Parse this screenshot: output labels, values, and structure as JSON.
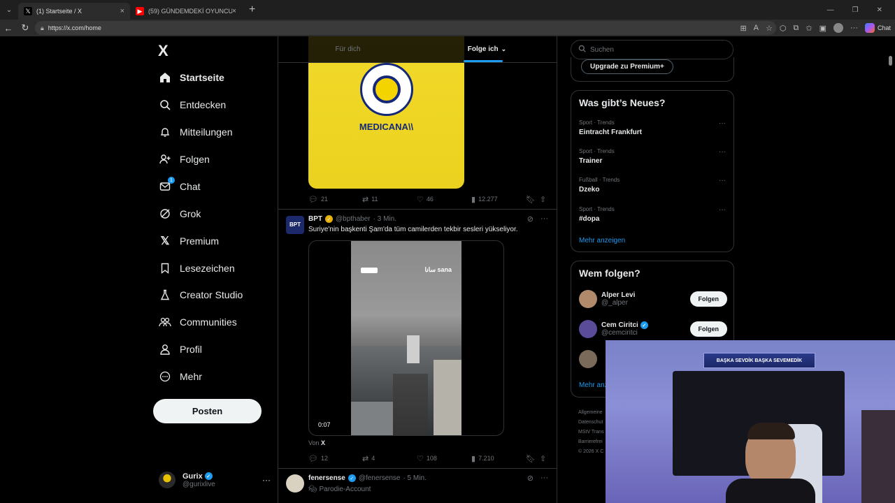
{
  "browser": {
    "tabs": [
      {
        "title": "(1) Startseite / X",
        "active": true
      },
      {
        "title": "(59) GÜNDEMDEKİ OYUNCULARD",
        "active": false
      }
    ],
    "url": "https://x.com/home",
    "chat_label": "Chat"
  },
  "nav": {
    "logo": "X",
    "items": [
      {
        "label": "Startseite",
        "icon": "home-icon",
        "active": true
      },
      {
        "label": "Entdecken",
        "icon": "search-icon"
      },
      {
        "label": "Mitteilungen",
        "icon": "bell-icon"
      },
      {
        "label": "Folgen",
        "icon": "person-add-icon"
      },
      {
        "label": "Chat",
        "icon": "mail-icon",
        "badge": "1"
      },
      {
        "label": "Grok",
        "icon": "grok-icon"
      },
      {
        "label": "Premium",
        "icon": "x-premium-icon"
      },
      {
        "label": "Lesezeichen",
        "icon": "bookmark-icon"
      },
      {
        "label": "Creator Studio",
        "icon": "creator-studio-icon"
      },
      {
        "label": "Communities",
        "icon": "communities-icon"
      },
      {
        "label": "Profil",
        "icon": "profile-icon"
      },
      {
        "label": "Mehr",
        "icon": "more-icon"
      }
    ],
    "post_button": "Posten",
    "account": {
      "name": "Gurix",
      "handle": "@gurixlive",
      "more": "···"
    }
  },
  "feed": {
    "tabs": [
      {
        "label": "Für dich",
        "active": false
      },
      {
        "label": "Folge ich",
        "active": true
      }
    ],
    "image_post": {
      "sponsor_text": "MEDICANA\\\\",
      "crest_text": "FENERBAHÇE SPOR KULÜBÜ 1907",
      "actions": {
        "replies": "21",
        "reposts": "11",
        "likes": "46",
        "views": "12.277"
      }
    },
    "bpt_post": {
      "name": "BPT",
      "handle": "@bpthaber",
      "time": "· 3 Min.",
      "text": "Suriye'nin başkenti Şam'da tüm camilerden tekbir sesleri yükseliyor.",
      "video_time": "0:07",
      "video_logo": "سانا\nsana",
      "from_label": "Von",
      "from_source": "X",
      "actions": {
        "replies": "12",
        "reposts": "4",
        "likes": "108",
        "views": "7.210"
      }
    },
    "fener_post": {
      "name": "fenersense",
      "handle": "@fenersense",
      "time": "· 5 Min.",
      "subtitle": "Parodie-Account"
    }
  },
  "sidebar": {
    "search_placeholder": "Suchen",
    "upgrade_label": "Upgrade zu Premium+",
    "trends_title": "Was gibt’s Neues?",
    "trends": [
      {
        "category": "Sport · Trends",
        "name": "Eintracht Frankfurt"
      },
      {
        "category": "Sport · Trends",
        "name": "Trainer"
      },
      {
        "category": "Fußball · Trends",
        "name": "Dzeko"
      },
      {
        "category": "Sport · Trends",
        "name": "#dopa"
      }
    ],
    "show_more": "Mehr anzeigen",
    "who_title": "Wem folgen?",
    "who": [
      {
        "name": "Alper Levi",
        "handle": "@_alper",
        "button": "Folgen"
      },
      {
        "name": "Cem Ciritci",
        "handle": "@cemciritci",
        "button": "Folgen",
        "verified": true
      }
    ],
    "who_show_more": "Mehr anz",
    "footer": [
      "Allgemeine",
      "Datenschut",
      "MStV Trans",
      "Barrierefrei",
      "© 2026 X C"
    ]
  },
  "webcam": {
    "banner": "BAŞKA SEVDİK BAŞKA SEVEMEDİK"
  },
  "colors": {
    "accent": "#1d9bf0",
    "background": "#000000",
    "fenerbahce_yellow": "#f2d92a",
    "fenerbahce_navy": "#14287a"
  }
}
